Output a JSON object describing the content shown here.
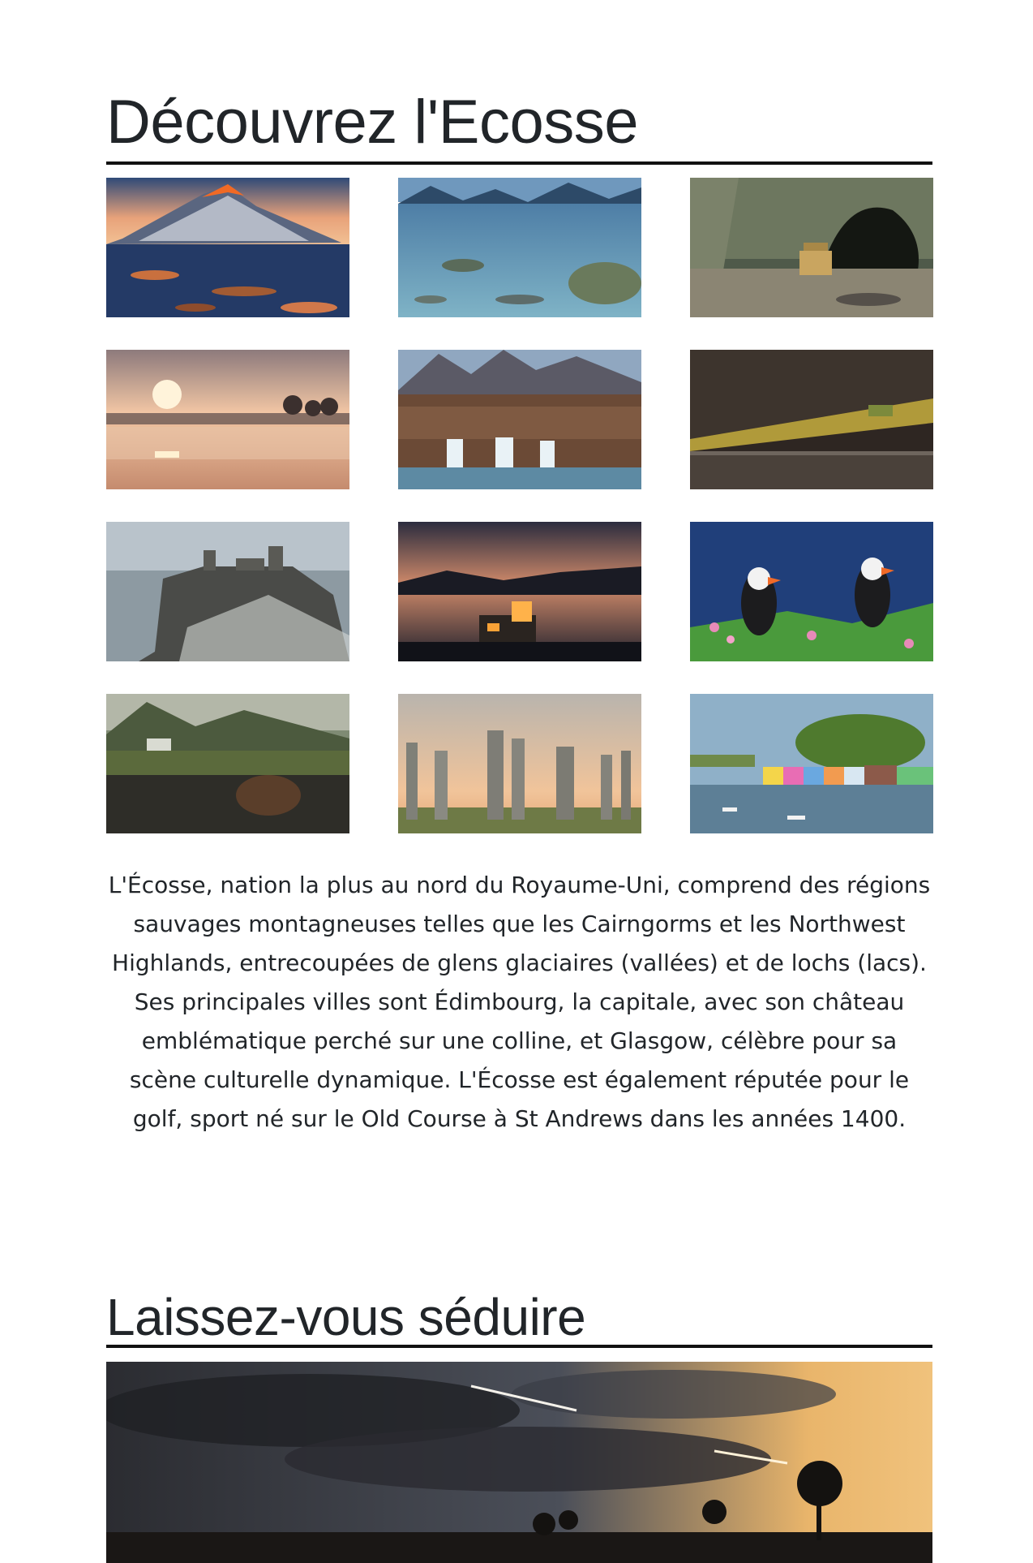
{
  "sections": {
    "discover": {
      "title": "Découvrez l'Ecosse",
      "description": "L'Écosse, nation la plus au nord du Royaume-Uni, comprend des régions sauvages montagneuses telles que les Cairngorms et les Northwest Highlands, entrecoupées de glens glaciaires (vallées) et de lochs (lacs). Ses principales villes sont Édimbourg, la capitale, avec son château emblématique perché sur une colline, et Glasgow, célèbre pour sa scène culturelle dynamique. L'Écosse est également réputée pour le golf, sport né sur le Old Course à St Andrews dans les années 1400."
    },
    "seduce": {
      "title": "Laissez-vous séduire"
    }
  },
  "gallery": [
    {
      "subject": "mountain-sunset-photo"
    },
    {
      "subject": "loch-shore-photo"
    },
    {
      "subject": "sea-cave-photo"
    },
    {
      "subject": "misty-lake-sunrise-photo"
    },
    {
      "subject": "waterfall-glen-photo"
    },
    {
      "subject": "valley-road-photo"
    },
    {
      "subject": "cliff-castle-ruin-photo"
    },
    {
      "subject": "castle-at-dusk-photo"
    },
    {
      "subject": "puffins-photo"
    },
    {
      "subject": "loch-castle-ruin-photo"
    },
    {
      "subject": "standing-stones-photo"
    },
    {
      "subject": "colorful-harbour-photo"
    }
  ],
  "hero": {
    "subject": "highland-sunset-sky-photo"
  },
  "colors": {
    "text": "#212529",
    "rule": "#111111",
    "background": "#ffffff"
  }
}
